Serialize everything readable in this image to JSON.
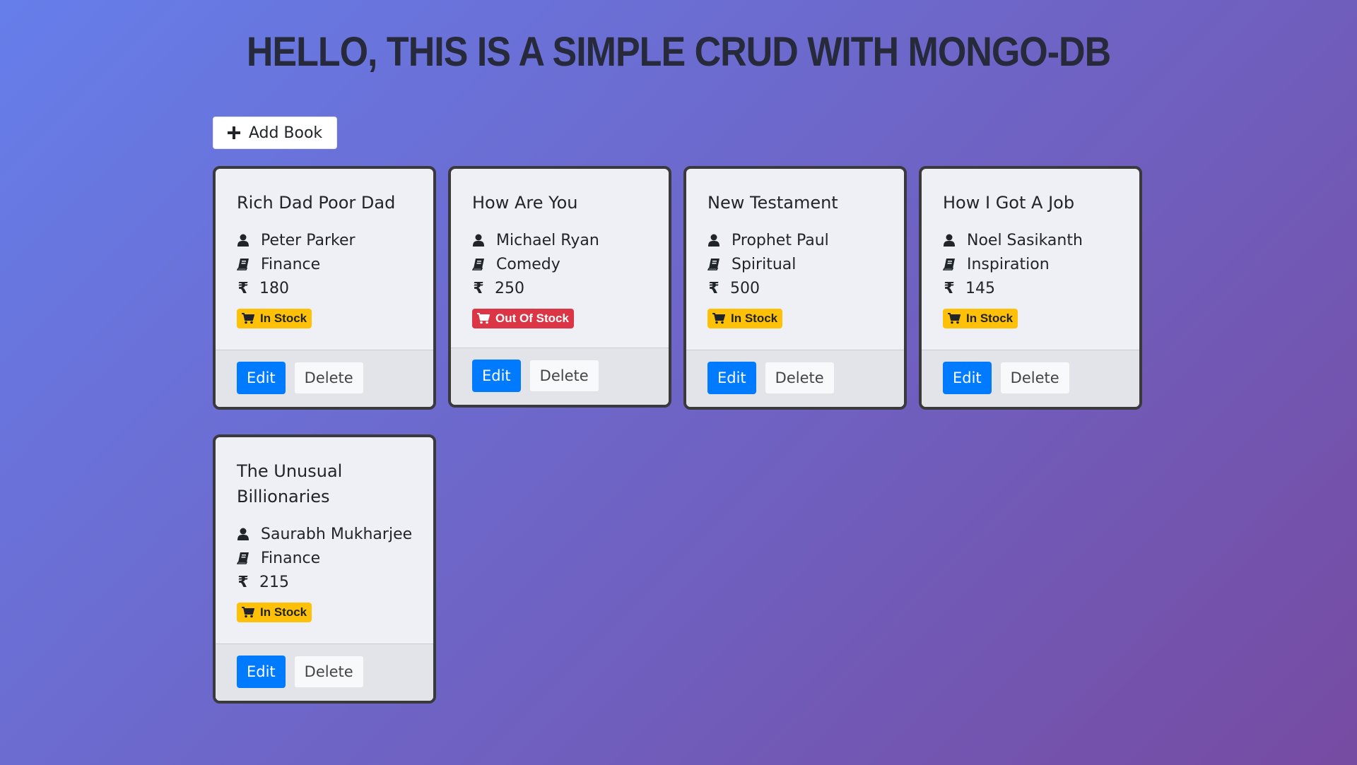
{
  "header": {
    "title": "Hello, This is a Simple CRUD with Mongo-DB"
  },
  "toolbar": {
    "add_label": "Add Book"
  },
  "labels": {
    "edit": "Edit",
    "delete": "Delete",
    "currency": "₹"
  },
  "colors": {
    "in_stock": "#ffc107",
    "out_of_stock": "#dc3545",
    "edit_button": "#007bff"
  },
  "books": [
    {
      "title": "Rich Dad Poor Dad",
      "author": "Peter Parker",
      "genre": "Finance",
      "price": "180",
      "stock": "In Stock"
    },
    {
      "title": "How Are You",
      "author": "Michael Ryan",
      "genre": "Comedy",
      "price": "250",
      "stock": "Out Of Stock"
    },
    {
      "title": "New Testament",
      "author": "Prophet Paul",
      "genre": "Spiritual",
      "price": "500",
      "stock": "In Stock"
    },
    {
      "title": "How I Got A Job",
      "author": "Noel Sasikanth",
      "genre": "Inspiration",
      "price": "145",
      "stock": "In Stock"
    },
    {
      "title": "The Unusual Billionaries",
      "author": "Saurabh Mukharjee",
      "genre": "Finance",
      "price": "215",
      "stock": "In Stock"
    }
  ]
}
